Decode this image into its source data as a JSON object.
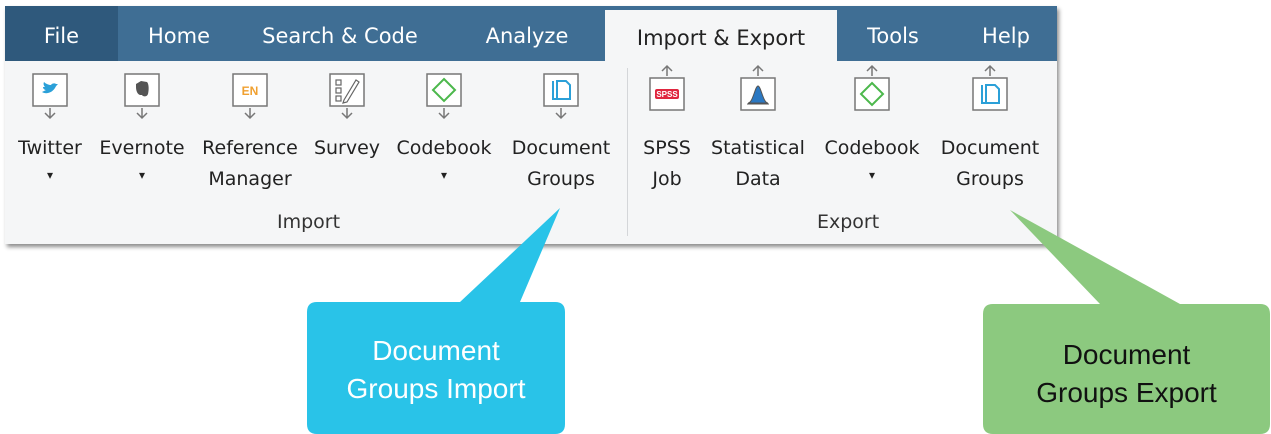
{
  "tabs": [
    {
      "label": "File"
    },
    {
      "label": "Home"
    },
    {
      "label": "Search & Code"
    },
    {
      "label": "Analyze"
    },
    {
      "label": "Import & Export"
    },
    {
      "label": "Tools"
    },
    {
      "label": "Help"
    }
  ],
  "import": {
    "group_label": "Import",
    "buttons": [
      {
        "line1": "Twitter",
        "line2": "▾",
        "icon": "twitter-icon"
      },
      {
        "line1": "Evernote",
        "line2": "▾",
        "icon": "evernote-icon"
      },
      {
        "line1": "Reference",
        "line2": "Manager",
        "icon": "reference-manager-icon",
        "icon_text": "EN"
      },
      {
        "line1": "Survey",
        "line2": "",
        "icon": "survey-icon"
      },
      {
        "line1": "Codebook",
        "line2": "▾",
        "icon": "codebook-icon"
      },
      {
        "line1": "Document",
        "line2": "Groups",
        "icon": "document-groups-icon"
      }
    ]
  },
  "export": {
    "group_label": "Export",
    "buttons": [
      {
        "line1": "SPSS",
        "line2": "Job",
        "icon": "spss-icon",
        "icon_text": "SPSS"
      },
      {
        "line1": "Statistical",
        "line2": "Data",
        "icon": "statistical-data-icon"
      },
      {
        "line1": "Codebook",
        "line2": "▾",
        "icon": "codebook-icon"
      },
      {
        "line1": "Document",
        "line2": "Groups",
        "icon": "document-groups-icon"
      }
    ]
  },
  "callouts": {
    "import": {
      "line1": "Document",
      "line2": "Groups Import",
      "color": "#29c3e8"
    },
    "export": {
      "line1": "Document",
      "line2": "Groups Export",
      "color": "#8cc97f"
    }
  },
  "colors": {
    "tabbar": "#3f6e94",
    "file_tab": "#2f597c",
    "ribbon_bg": "#f5f6f7",
    "icon_accent": "#2ba0d8",
    "codebook_green": "#4cb84c",
    "reference_orange": "#f0a030",
    "spss_red": "#e0263f"
  }
}
